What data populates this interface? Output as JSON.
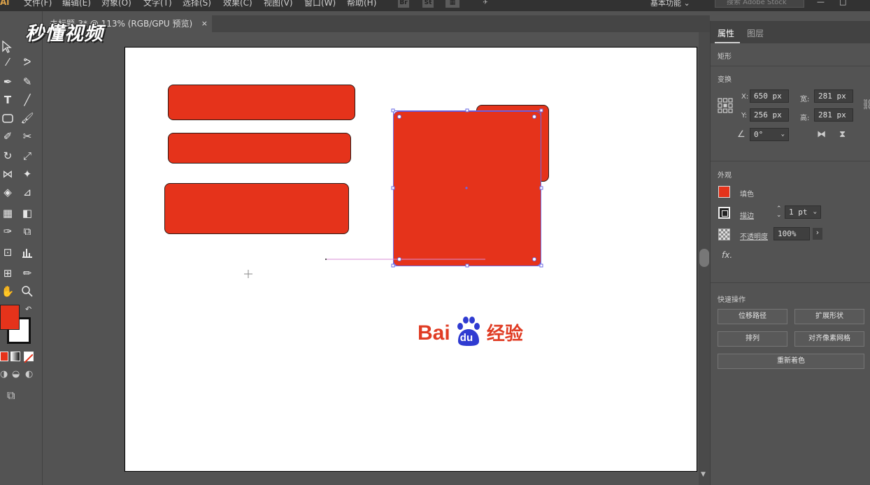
{
  "app": {
    "logo": "Ai",
    "menus": [
      "文件(F)",
      "编辑(E)",
      "对象(O)",
      "文字(T)",
      "选择(S)",
      "效果(C)",
      "视图(V)",
      "窗口(W)",
      "帮助(H)"
    ],
    "bridge_label": "Br",
    "stock_label": "St",
    "workspace": "基本功能",
    "search_placeholder": "搜索 Adobe Stock"
  },
  "document": {
    "tab_title": "未标题-3* @ 113% (RGB/GPU 预览)",
    "close_glyph": "×"
  },
  "watermark": "秒懂视频",
  "artwork": {
    "fill_color": "#e5331b",
    "baidu_logo_text": "Bai",
    "baidu_logo_du": "du",
    "baidu_logo_suffix": "经验"
  },
  "panel": {
    "tabs": [
      "属性",
      "图层"
    ],
    "object_type": "矩形",
    "transform": {
      "section": "变换",
      "x_label": "X:",
      "x_value": "650 px",
      "y_label": "Y:",
      "y_value": "256 px",
      "w_label": "宽:",
      "w_value": "281 px",
      "h_label": "高:",
      "h_value": "281 px",
      "angle_value": "0°"
    },
    "appearance": {
      "section": "外观",
      "fill_label": "填色",
      "stroke_label": "描边",
      "stroke_value": "1 pt",
      "opacity_label": "不透明度",
      "opacity_value": "100%",
      "fx_label": "fx."
    },
    "quick_actions": {
      "section": "快速操作",
      "offset_path": "位移路径",
      "expand_shape": "扩展形状",
      "arrange": "排列",
      "align_pixel": "对齐像素网格",
      "recolor": "重新着色"
    }
  }
}
